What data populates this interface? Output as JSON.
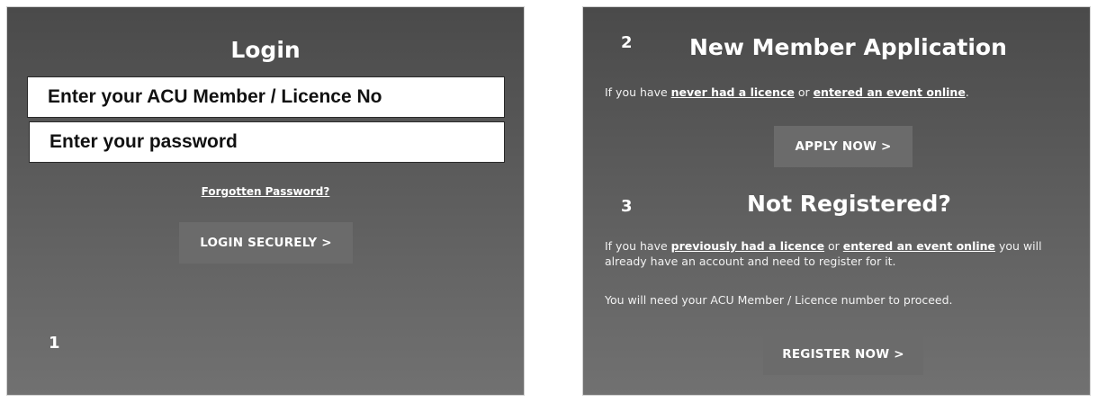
{
  "login_panel": {
    "title": "Login",
    "member_placeholder": "Enter your ACU Member / Licence No",
    "password_placeholder": "Enter your password",
    "forgotten_link": "Forgotten Password?",
    "login_button": "LOGIN SECURELY >",
    "step_number": "1"
  },
  "new_member_panel": {
    "step_number": "2",
    "title": "New Member Application",
    "text_prefix": "If you have ",
    "link_never": "never had a licence",
    "text_or": " or ",
    "link_entered": "entered an event online",
    "text_suffix": ".",
    "apply_button": "APPLY NOW >"
  },
  "not_registered_panel": {
    "step_number": "3",
    "title": "Not Registered?",
    "text_prefix": "If you have ",
    "link_previously": "previously had a licence",
    "text_or": " or ",
    "link_entered": "entered an event online",
    "text_suffix": " you will already have an account and need to register for it.",
    "note": "You will need your ACU Member / Licence number to proceed.",
    "register_button": "REGISTER NOW >"
  }
}
